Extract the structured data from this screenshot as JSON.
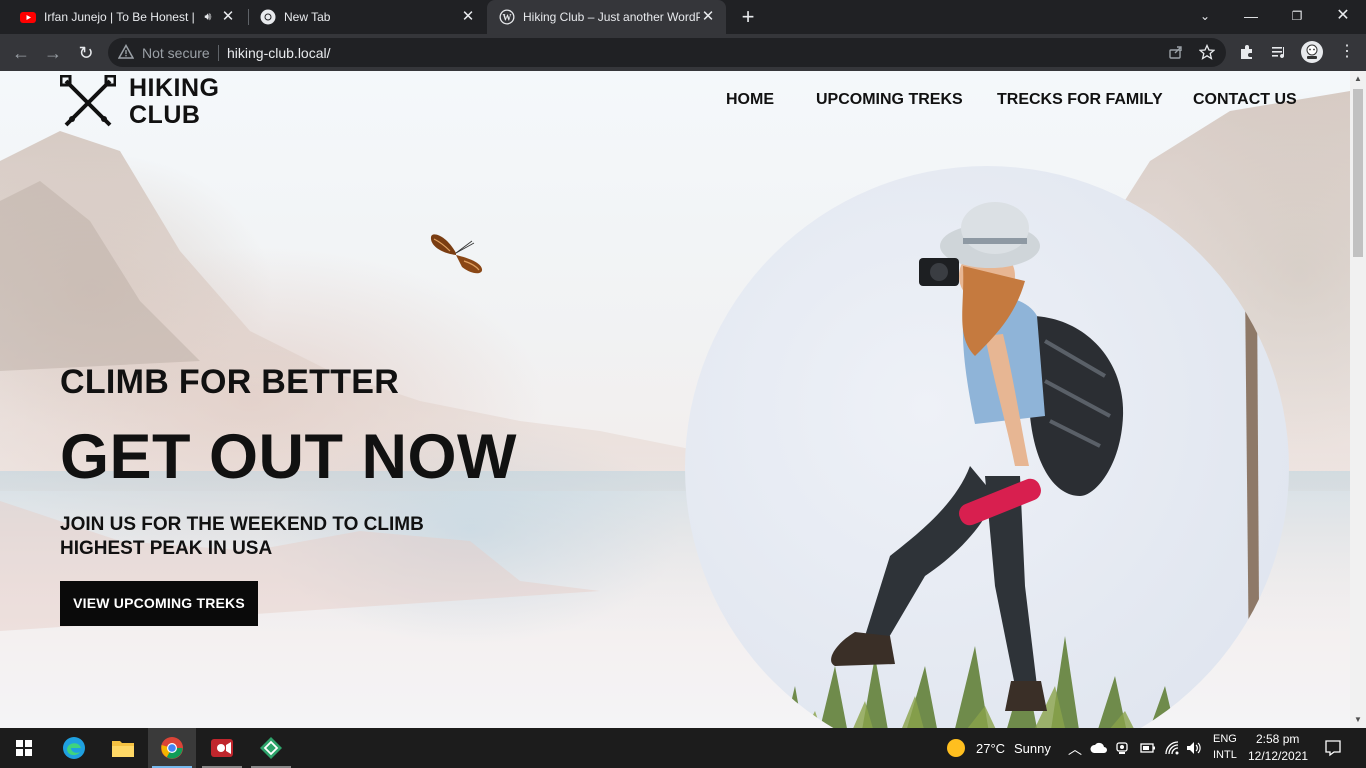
{
  "browser": {
    "tabs": [
      {
        "title": "Irfan Junejo | To Be Honest |",
        "favicon": "youtube-icon",
        "audio": true
      },
      {
        "title": "New Tab",
        "favicon": "chrome-icon"
      },
      {
        "title": "Hiking Club – Just another WordPress site",
        "favicon": "wordpress-icon",
        "active": true
      }
    ],
    "address": {
      "security_label": "Not secure",
      "url": "hiking-club.local/"
    }
  },
  "site": {
    "logo": {
      "line1": "HIKING",
      "line2": "CLUB",
      "icon": "crossed-trekking-poles-icon"
    },
    "nav": [
      "HOME",
      "UPCOMING TREKS",
      "TRECKS FOR FAMILY",
      "CONTACT US"
    ],
    "hero": {
      "kicker": "CLIMB FOR BETTER",
      "headline": "GET OUT NOW",
      "description": "JOIN US FOR THE WEEKEND TO CLIMB HIGHEST PEAK IN USA",
      "cta": "VIEW UPCOMING TREKS"
    },
    "colors": {
      "text": "#111111",
      "button_bg": "#0a0a0a",
      "button_text": "#ffffff"
    }
  },
  "taskbar": {
    "apps": [
      "windows-start-icon",
      "edge-icon",
      "file-explorer-icon",
      "chrome-icon",
      "screen-recorder-icon",
      "gitkraken-icon"
    ],
    "weather": {
      "temp": "27°C",
      "condition": "Sunny"
    },
    "lang": {
      "line1": "ENG",
      "line2": "INTL"
    },
    "time": "2:58 pm",
    "date": "12/12/2021"
  }
}
